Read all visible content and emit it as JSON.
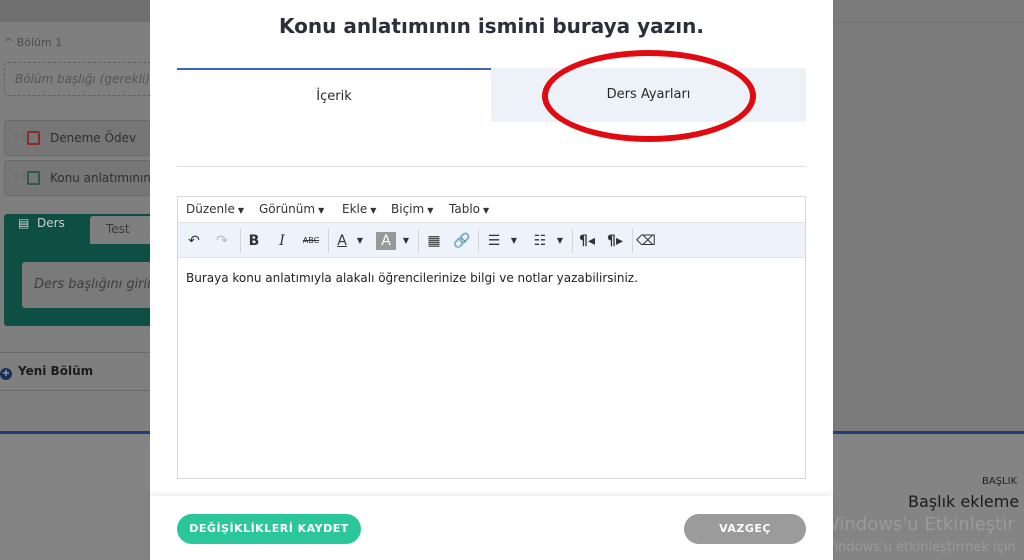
{
  "background": {
    "section_label": "Bölüm 1",
    "section_title_placeholder": "Bölüm başlığı (gerekli)",
    "items": [
      {
        "label": "Deneme Ödev",
        "icon": "task-icon"
      },
      {
        "label": "Konu anlatımının",
        "icon": "document-icon"
      }
    ],
    "lesson_tab": "Ders",
    "test_tab": "Test",
    "lesson_title_placeholder": "Ders başlığını girin",
    "new_section": "Yeni Bölüm",
    "heading_small": "BAŞLIK",
    "heading_big": "Başlık ekleme",
    "windows_line1": "Windows'u Etkinleştir",
    "windows_line2": "Windows'u etkinleştirmek için"
  },
  "modal": {
    "title": "Konu anlatımının ismini buraya yazın.",
    "tabs": [
      "İçerik",
      "Ders Ayarları"
    ],
    "editor": {
      "menus": [
        "Düzenle",
        "Görünüm",
        "Ekle",
        "Biçim",
        "Tablo"
      ],
      "content": "Buraya konu anlatımıyla alakalı öğrencilerinize bilgi ve notlar yazabilirsiniz."
    },
    "save_button": "DEĞİŞİKLİKLERİ KAYDET",
    "cancel_button": "VAZGEÇ"
  },
  "colors": {
    "accent_green": "#2cc69b",
    "tab_active_border": "#3a64c8",
    "highlight_ellipse": "#e00a10"
  }
}
